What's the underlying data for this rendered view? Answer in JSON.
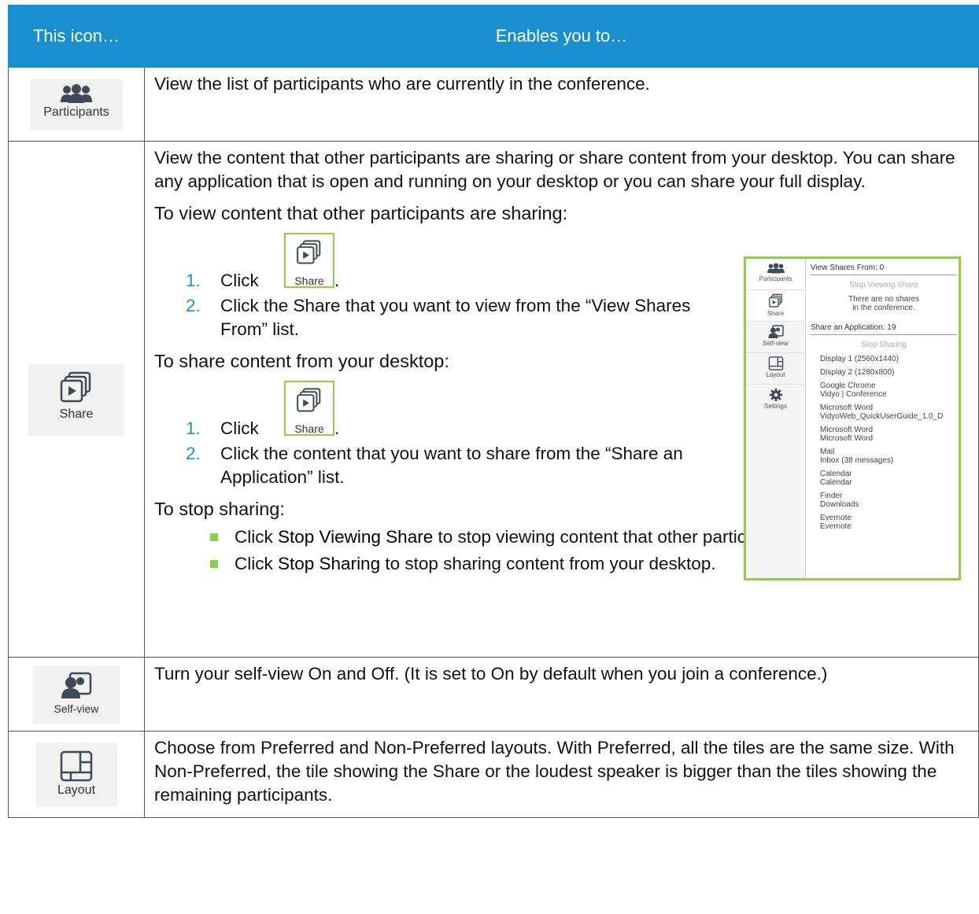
{
  "header": {
    "col1": "This icon…",
    "col2": "Enables you to…"
  },
  "rows": {
    "participants": {
      "icon_name": "participants-icon",
      "label": "Participants",
      "desc": "View the list of participants who are currently in the conference."
    },
    "share": {
      "icon_name": "share-icon",
      "label": "Share",
      "intro": "View the content that other participants are sharing or share content from your desktop. You can share any application that is open and running on your desktop or you can share your full display.",
      "view_heading": "To view content that other participants are sharing:",
      "view_steps": [
        "Click",
        "Click the Share that you want to view from the “View Shares From” list."
      ],
      "share_heading": "To share content from your desktop:",
      "share_steps": [
        "Click",
        "Click the content that you want to share from the “Share an Application” list."
      ],
      "stop_heading": "To stop sharing:",
      "stop_items": [
        {
          "bold": "Stop Viewing Share",
          "rest": " to stop viewing content that other participants are sharing."
        },
        {
          "bold": "Stop Sharing",
          "rest": " to stop sharing content from your desktop."
        }
      ],
      "click_word": "Click",
      "step_numbers": [
        "1.",
        "2."
      ],
      "button_label": "Share",
      "period": "."
    },
    "selfview": {
      "icon_name": "self-view-icon",
      "label": "Self-view",
      "desc": "Turn your self-view On and Off. (It is set to On by default when you join a conference.)"
    },
    "layout": {
      "icon_name": "layout-icon",
      "label": "Layout",
      "desc": "Choose from Preferred and Non-Preferred layouts. With Preferred, all the tiles are the same size. With Non-Preferred, the tile showing the Share or the loudest speaker is bigger than the tiles showing the remaining participants."
    }
  },
  "screenshot": {
    "sidebar": [
      "Participants",
      "Share",
      "Self-view",
      "Layout",
      "Settings"
    ],
    "view_header": "View Shares From: 0",
    "stop_viewing": "Stop Viewing Share",
    "no_shares_1": "There are no shares",
    "no_shares_2": "in the conference.",
    "share_header": "Share an Application: 19",
    "stop_sharing": "Stop Sharing",
    "apps": [
      [
        "Display 1 (2560x1440)",
        ""
      ],
      [
        "Display 2 (1280x800)",
        ""
      ],
      [
        "Google Chrome",
        "Vidyo | Conference"
      ],
      [
        "Microsoft Word",
        "VidyoWeb_QuickUserGuide_1.0_D"
      ],
      [
        "Microsoft Word",
        "Microsoft Word"
      ],
      [
        "Mail",
        "Inbox (38 messages)"
      ],
      [
        "Calendar",
        "Calendar"
      ],
      [
        "Finder",
        "Downloads"
      ],
      [
        "Evernote",
        "Evernote"
      ]
    ]
  },
  "colors": {
    "header_blue": "#1a8fcf",
    "accent_green": "#8cd04a"
  }
}
